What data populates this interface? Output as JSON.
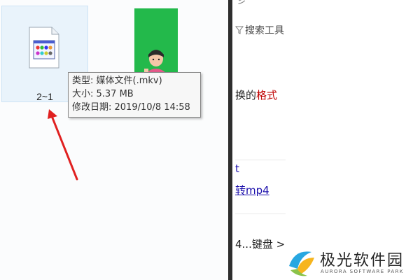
{
  "explorer": {
    "file": {
      "name": "2~1",
      "icon": "media-file-icon"
    },
    "thumbnail": {
      "icon": "video-thumbnail-icon"
    },
    "tooltip": {
      "type": "类型: 媒体文件(.mkv)",
      "size": "大小: 5.37 MB",
      "modified": "修改日期: 2019/10/8 14:58"
    },
    "annotation": {
      "icon": "red-arrow-icon",
      "color": "#e02020"
    }
  },
  "right_pane": {
    "top_fragment": "彡",
    "search_tools_label": "搜索工具",
    "result1_prefix": "换的",
    "result1_highlight": "格式",
    "result2_prefix": "t",
    "result2_link": "转mp4",
    "result3": "4...键盘 >"
  },
  "watermark": {
    "name": "极光软件园",
    "subtitle": "AURORA SOFTWARE PARK",
    "icon": "aurora-logo-icon"
  }
}
